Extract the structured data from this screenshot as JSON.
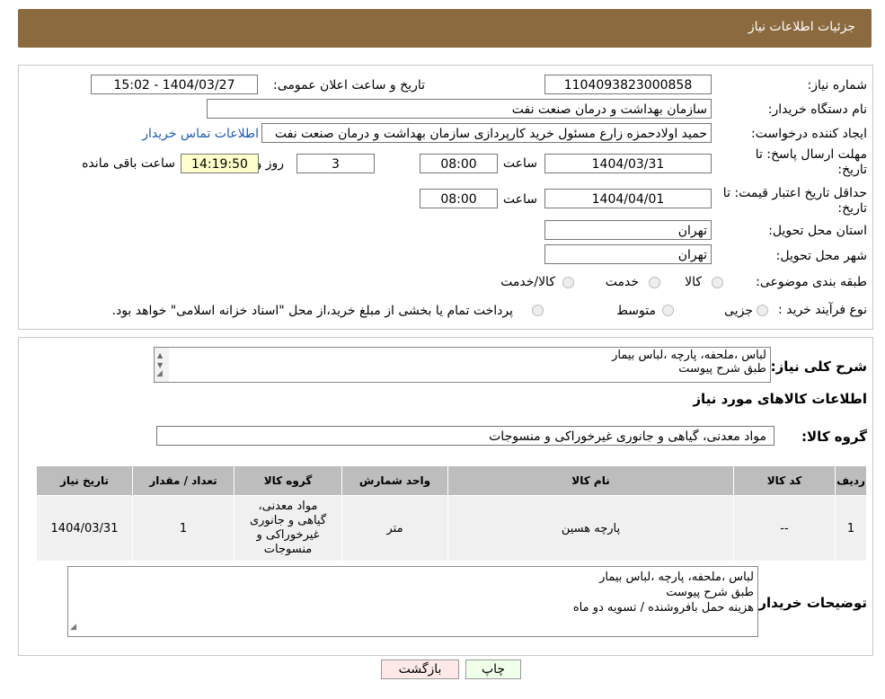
{
  "header": {
    "title": "جزئیات اطلاعات نیاز"
  },
  "form": {
    "need_number_label": "شماره نیاز:",
    "need_number": "1104093823000858",
    "announce_label": "تاریخ و ساعت اعلان عمومی:",
    "announce_value": "1404/03/27 - 15:02",
    "buyer_org_label": "نام دستگاه خریدار:",
    "buyer_org": "سازمان بهداشت و درمان صنعت نفت",
    "creator_label": "ایجاد کننده درخواست:",
    "creator": "حمید اولادحمزه زارع مسئول خرید کارپردازی سازمان بهداشت و درمان صنعت نفت",
    "contact_link": "اطلاعات تماس خریدار",
    "deadline_label_1": "مهلت ارسال پاسخ: تا",
    "deadline_label_2": "تاریخ:",
    "deadline_date": "1404/03/31",
    "time_label": "ساعت",
    "deadline_time": "08:00",
    "days": "3",
    "day_label": "روز و",
    "remaining": "14:19:50",
    "remaining_label": "ساعت باقی مانده",
    "validity_label_1": "حداقل تاریخ اعتبار قیمت: تا",
    "validity_label_2": "تاریخ:",
    "validity_date": "1404/04/01",
    "validity_time": "08:00",
    "province_label": "استان محل تحویل:",
    "province": "تهران",
    "city_label": "شهر محل تحویل:",
    "city": "تهران",
    "category_label": "طبقه بندی موضوعی:",
    "category_options": [
      "کالا",
      "خدمت",
      "کالا/خدمت"
    ],
    "process_label": "نوع فرآیند خرید :",
    "process_options": [
      "جزیی",
      "متوسط"
    ],
    "process_note": "پرداخت تمام یا بخشی از مبلغ خرید،از محل \"اسناد خزانه اسلامی\" خواهد بود."
  },
  "summary": {
    "label": "شرح کلی نیاز:",
    "text_line1": "لباس ،ملحفه، پارچه ،لباس بیمار",
    "text_line2": "طبق شرح پیوست",
    "items_title": "اطلاعات کالاهای مورد نیاز",
    "group_label": "گروه کالا:",
    "group_value": "مواد معدنی، گیاهی و جانوری غیرخوراکی و منسوجات"
  },
  "table": {
    "headers": [
      "ردیف",
      "کد کالا",
      "نام کالا",
      "واحد شمارش",
      "گروه کالا",
      "تعداد / مقدار",
      "تاریخ نیاز"
    ],
    "rows": [
      {
        "row": "1",
        "code": "--",
        "name": "پارچه هسین",
        "unit": "متر",
        "group_l1": "مواد معدنی،",
        "group_l2": "گیاهی و جانوری",
        "group_l3": "غیرخوراکی و",
        "group_l4": "منسوجات",
        "qty": "1",
        "date": "1404/03/31"
      }
    ]
  },
  "buyer_notes": {
    "label": "توضیحات خریدار:",
    "line1": "لباس ،ملحفه، پارچه ،لباس بیمار",
    "line2": "طبق شرح پیوست",
    "line3": "هزینه حمل بافروشنده / تسویه دو ماه"
  },
  "buttons": {
    "print": "چاپ",
    "back": "بازگشت"
  },
  "colors": {
    "header_bg": "#8b6a3f",
    "link": "#1a5ab4",
    "remaining_bg": "#ffffcc",
    "print_bg": "#efffe8",
    "back_bg": "#ffe8e8"
  }
}
